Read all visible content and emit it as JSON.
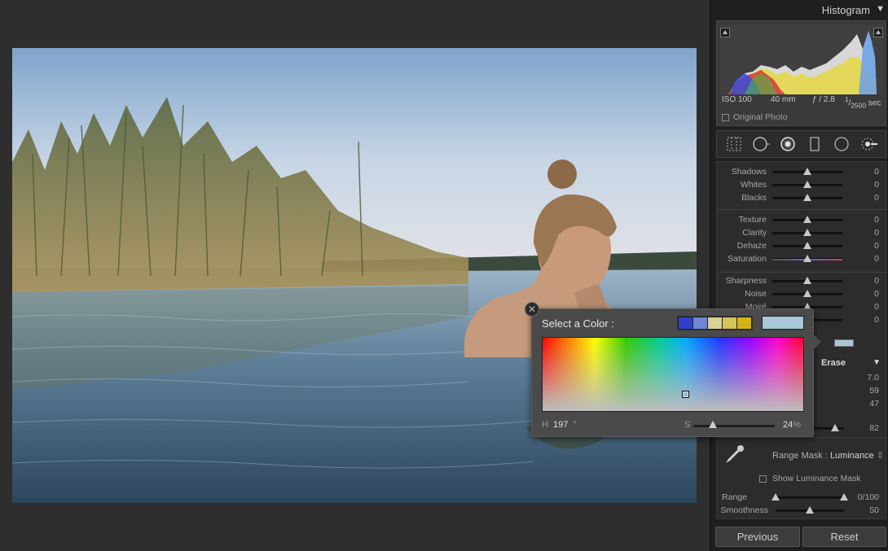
{
  "histogram": {
    "title": "Histogram",
    "iso": "ISO 100",
    "focal": "40 mm",
    "aperture": "ƒ / 2.8",
    "shutter_num": "1",
    "shutter_den": "2500",
    "shutter_unit": "sec",
    "original_photo_label": "Original Photo"
  },
  "tools": [
    "grid-crop-icon",
    "spot-removal-icon",
    "red-eye-icon",
    "graduated-filter-icon",
    "radial-filter-icon",
    "adjustment-brush-icon"
  ],
  "sliders": [
    {
      "label": "Shadows",
      "value": "0",
      "pos": 0.5
    },
    {
      "label": "Whites",
      "value": "0",
      "pos": 0.5
    },
    {
      "label": "Blacks",
      "value": "0",
      "pos": 0.5
    },
    {
      "label": "Texture",
      "value": "0",
      "pos": 0.5
    },
    {
      "label": "Clarity",
      "value": "0",
      "pos": 0.5
    },
    {
      "label": "Dehaze",
      "value": "0",
      "pos": 0.5
    },
    {
      "label": "Saturation",
      "value": "0",
      "pos": 0.5
    },
    {
      "label": "Sharpness",
      "value": "0",
      "pos": 0.5
    },
    {
      "label": "Noise",
      "value": "0",
      "pos": 0.5
    },
    {
      "label": "Moiré",
      "value": "0",
      "pos": 0.5
    },
    {
      "label": "",
      "value": "0",
      "pos": 0.5
    }
  ],
  "brush": {
    "erase_label": "Erase",
    "values": [
      "7.0",
      "59",
      "47",
      "82"
    ]
  },
  "range_mask": {
    "label": "Range Mask :",
    "mode": "Luminance",
    "show_mask_label": "Show Luminance Mask",
    "range_label": "Range",
    "range_value": "0/100",
    "smoothness_label": "Smoothness",
    "smoothness_value": "50"
  },
  "buttons": {
    "previous": "Previous",
    "reset": "Reset"
  },
  "color_popup": {
    "title": "Select a Color :",
    "swatches": [
      "#2e3fc9",
      "#6f86d6",
      "#d9d19a",
      "#d4c45a",
      "#d4b414"
    ],
    "current_color": "#a8c8d8",
    "h_label": "H",
    "h_value": "197",
    "h_unit": "°",
    "s_label": "S",
    "s_value": "24",
    "s_unit": "%",
    "s_level": 0.24
  }
}
